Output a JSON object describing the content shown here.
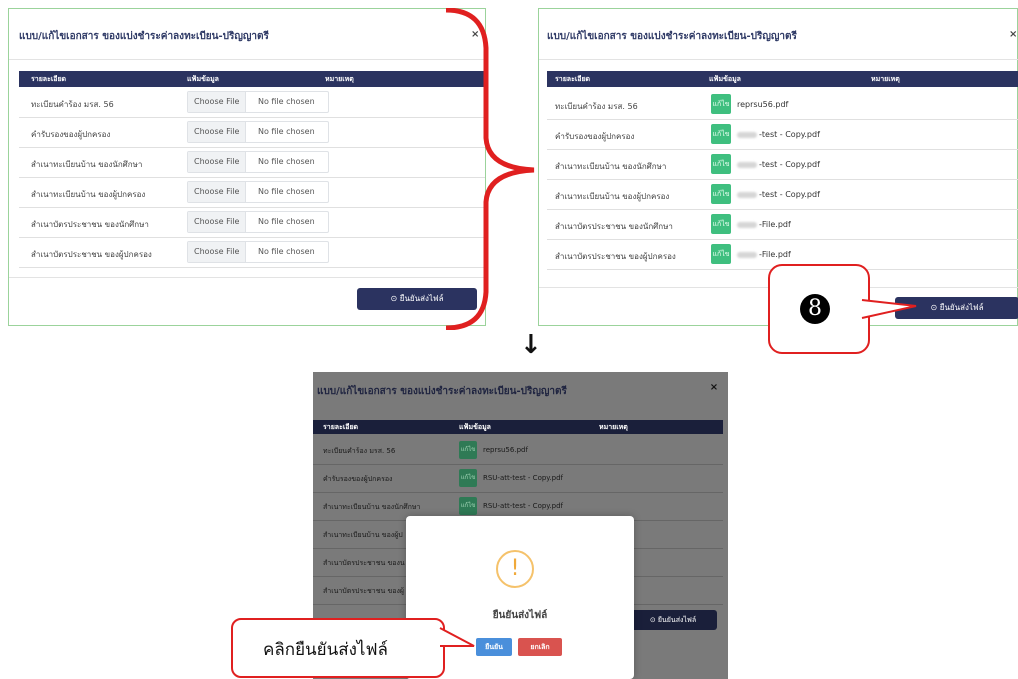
{
  "modal_title": "แบบ/แก้ไขเอกสาร ของแบ่งชำระค่าลงทะเบียน-ปริญญาตรี",
  "close_symbol": "×",
  "table_headers": {
    "detail": "รายละเอียด",
    "file": "แฟ้มข้อมูล",
    "note": "หมายเหตุ"
  },
  "rows": [
    "ทะเบียนคำร้อง มรส. 56",
    "คำรับรองของผู้ปกครอง",
    "สำเนาทะเบียนบ้าน ของนักศึกษา",
    "สำเนาทะเบียนบ้าน ของผู้ปกครอง",
    "สำเนาบัตรประชาชน ของนักศึกษา",
    "สำเนาบัตรประชาชน ของผู้ปกครอง"
  ],
  "rows_partial": [
    "ทะเบียนคำร้อง มรส. 56",
    "คำรับรองของผู้ปกครอง",
    "สำเนาทะเบียนบ้าน ของนักศึกษา",
    "สำเนาทะเบียนบ้าน ของผู้ป",
    "สำเนาบัตรประชาชน ของน",
    "สำเนาบัตรประชาชน ของผู้"
  ],
  "file_input": {
    "choose": "Choose File",
    "no_file": "No file chosen"
  },
  "edit_badge": "แก้ไข",
  "uploaded_files_b": [
    "reprsu56.pdf",
    "-test - Copy.pdf",
    "-test - Copy.pdf",
    "-test - Copy.pdf",
    "-File.pdf",
    "-File.pdf"
  ],
  "uploaded_files_c": [
    "reprsu56.pdf",
    "RSU-att-test - Copy.pdf",
    "RSU-att-test - Copy.pdf"
  ],
  "submit_button": "⊙ ยืนยันส่งไฟล์",
  "step_number": "8",
  "arrow_down": "↓",
  "confirm_dialog": {
    "icon": "!",
    "message": "ยืนยันส่งไฟล์",
    "confirm": "ยืนยัน",
    "cancel": "ยกเลิก"
  },
  "callout_instruction": "คลิกยืนยันส่งไฟล์",
  "colors": {
    "header": "#2b3360",
    "edit_badge": "#3fbf7f",
    "callout_border": "#e02020",
    "confirm": "#4a8fdb",
    "cancel": "#d9534f",
    "warning": "#f5c26b"
  }
}
